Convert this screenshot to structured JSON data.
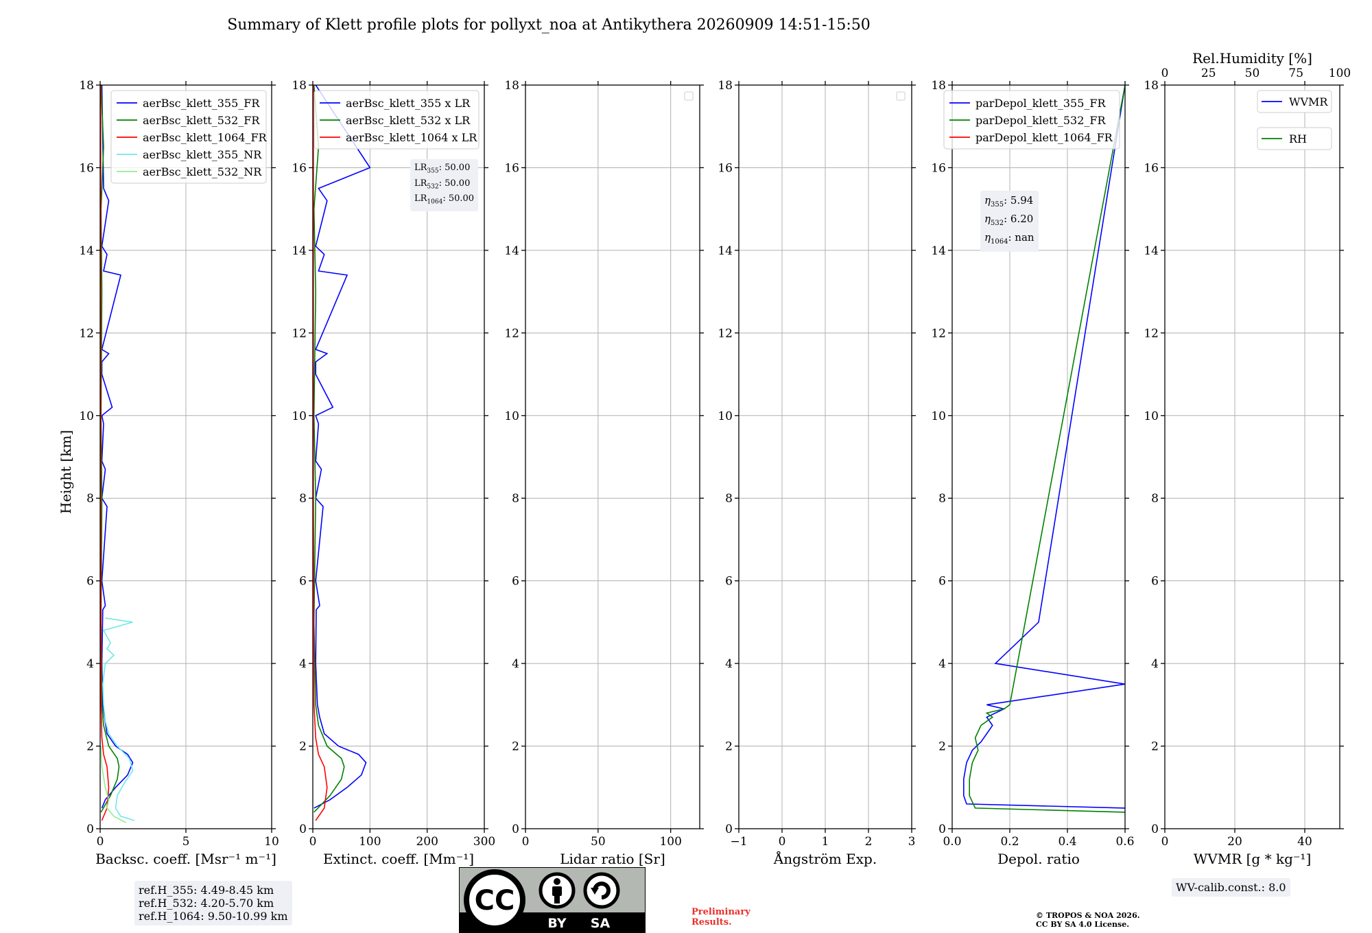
{
  "figure": {
    "title": "Summary of Klett profile plots for pollyxt_noa at Antikythera 20260909 14:51-15:50",
    "ylabel": "Height [km]"
  },
  "chart_data": [
    {
      "id": "backscatter",
      "type": "line",
      "xlabel": "Backsc. coeff. [Msr⁻¹ m⁻¹]",
      "ylabel": "Height [km]",
      "xlim": [
        0,
        10
      ],
      "ylim": [
        0,
        18
      ],
      "xticks": [
        "0",
        "5",
        "10"
      ],
      "yticks": [
        "0",
        "2",
        "4",
        "6",
        "8",
        "10",
        "12",
        "14",
        "16",
        "18"
      ],
      "grid": true,
      "legend": "top-right",
      "series": [
        {
          "name": "aerBsc_klett_355_FR",
          "color": "#0000ff",
          "x": [
            0.1,
            0.3,
            0.9,
            1.6,
            1.9,
            1.6,
            0.9,
            0.4,
            0.25,
            0.15,
            0.1,
            0.15,
            0.3,
            0.1,
            0.4,
            0.1,
            0.3,
            0.1,
            0.2,
            0.1,
            0.7,
            0.1,
            0.1,
            0.5,
            0.1,
            1.2,
            0.2,
            0.4,
            0.1,
            0.5,
            0.2,
            0.1
          ],
          "y": [
            0.5,
            0.7,
            1.0,
            1.3,
            1.6,
            1.8,
            2.0,
            2.3,
            2.7,
            3.0,
            4.0,
            5.3,
            5.4,
            6.0,
            7.8,
            8.0,
            8.7,
            8.9,
            9.8,
            10.0,
            10.2,
            11.0,
            11.3,
            11.5,
            11.6,
            13.4,
            13.5,
            13.9,
            14.1,
            15.2,
            15.5,
            18.0
          ]
        },
        {
          "name": "aerBsc_klett_532_FR",
          "color": "#008000",
          "x": [
            0.05,
            0.6,
            1.0,
            1.1,
            1.0,
            0.5,
            0.2,
            0.1,
            0.05,
            0.1,
            0.05,
            0.1,
            0.05,
            0.2,
            0.05
          ],
          "y": [
            0.4,
            0.8,
            1.2,
            1.5,
            1.7,
            2.0,
            2.5,
            3.0,
            5.0,
            8.0,
            10.0,
            13.0,
            15.0,
            16.5,
            18.0
          ]
        },
        {
          "name": "aerBsc_klett_1064_FR",
          "color": "#ff0000",
          "x": [
            0.1,
            0.4,
            0.5,
            0.4,
            0.2,
            0.1,
            0.05,
            0.03,
            0.03
          ],
          "y": [
            0.2,
            0.5,
            1.0,
            1.5,
            1.8,
            2.2,
            3.0,
            8.0,
            18.0
          ]
        },
        {
          "name": "aerBsc_klett_355_NR",
          "color": "#6fe8e8",
          "x": [
            2.0,
            1.2,
            0.9,
            1.0,
            1.4,
            1.9,
            1.7,
            1.0,
            0.5,
            0.3,
            0.2,
            0.15,
            0.3,
            0.8,
            0.4,
            0.6,
            0.2,
            1.9,
            0.3
          ],
          "y": [
            0.2,
            0.3,
            0.5,
            0.8,
            1.1,
            1.4,
            1.7,
            2.0,
            2.3,
            2.6,
            3.0,
            3.5,
            4.0,
            4.2,
            4.35,
            4.5,
            4.8,
            5.0,
            5.1
          ]
        },
        {
          "name": "aerBsc_klett_532_NR",
          "color": "#90ee90",
          "x": [
            1.5,
            0.8,
            0.4,
            0.5,
            0.3,
            0.1,
            0.05
          ],
          "y": [
            0.15,
            0.3,
            0.5,
            0.7,
            1.0,
            1.5,
            2.0
          ]
        }
      ],
      "annotations": {
        "refH": [
          "ref.H_355: 4.49-8.45 km",
          "ref.H_532: 4.20-5.70 km",
          "ref.H_1064: 9.50-10.99 km"
        ]
      }
    },
    {
      "id": "extinction",
      "type": "line",
      "xlabel": "Extinct. coeff. [Mm⁻¹]",
      "xlim": [
        0,
        300
      ],
      "ylim": [
        0,
        18
      ],
      "xticks": [
        "0",
        "100",
        "200",
        "300"
      ],
      "yticks": [
        "0",
        "2",
        "4",
        "6",
        "8",
        "10",
        "12",
        "14",
        "16",
        "18"
      ],
      "grid": true,
      "legend": "top-right",
      "series": [
        {
          "name": "aerBsc_klett_355 x LR",
          "color": "#0000ff",
          "x": [
            2,
            30,
            60,
            85,
            93,
            80,
            45,
            20,
            12,
            8,
            5,
            6,
            12,
            5,
            18,
            5,
            15,
            5,
            10,
            5,
            35,
            5,
            5,
            25,
            5,
            60,
            10,
            20,
            5,
            25,
            10,
            100,
            5
          ],
          "y": [
            0.5,
            0.7,
            1.0,
            1.3,
            1.6,
            1.8,
            2.0,
            2.3,
            2.7,
            3.0,
            4.0,
            5.3,
            5.4,
            6.0,
            7.8,
            8.0,
            8.7,
            8.9,
            9.8,
            10.0,
            10.2,
            11.0,
            11.3,
            11.5,
            11.6,
            13.4,
            13.5,
            13.9,
            14.1,
            15.2,
            15.5,
            16.0,
            18.0
          ]
        },
        {
          "name": "aerBsc_klett_532 x LR",
          "color": "#008000",
          "x": [
            2,
            30,
            50,
            55,
            50,
            25,
            10,
            5,
            2,
            5,
            2,
            5,
            2,
            10,
            2
          ],
          "y": [
            0.4,
            0.8,
            1.2,
            1.5,
            1.7,
            2.0,
            2.5,
            3.0,
            5.0,
            8.0,
            10.0,
            13.0,
            15.0,
            16.5,
            18.0
          ]
        },
        {
          "name": "aerBsc_klett_1064 x LR",
          "color": "#ff0000",
          "x": [
            5,
            20,
            25,
            20,
            10,
            5,
            2,
            1,
            1
          ],
          "y": [
            0.2,
            0.5,
            1.0,
            1.5,
            1.8,
            2.2,
            3.0,
            8.0,
            18.0
          ]
        }
      ],
      "annotations": {
        "LR355": "50.00",
        "LR532": "50.00",
        "LR1064": "50.00"
      }
    },
    {
      "id": "lidar_ratio",
      "type": "line",
      "xlabel": "Lidar ratio [Sr]",
      "xlim": [
        0,
        120
      ],
      "ylim": [
        0,
        18
      ],
      "xticks": [
        "0",
        "50",
        "100"
      ],
      "yticks": [
        "0",
        "2",
        "4",
        "6",
        "8",
        "10",
        "12",
        "14",
        "16",
        "18"
      ],
      "grid": true,
      "series": []
    },
    {
      "id": "angstrom",
      "type": "line",
      "xlabel": "Ångström Exp.",
      "xlim": [
        -1,
        3
      ],
      "ylim": [
        0,
        18
      ],
      "xticks": [
        "−1",
        "0",
        "1",
        "2",
        "3"
      ],
      "yticks": [
        "0",
        "2",
        "4",
        "6",
        "8",
        "10",
        "12",
        "14",
        "16",
        "18"
      ],
      "grid": true,
      "series": []
    },
    {
      "id": "depol",
      "type": "line",
      "xlabel": "Depol. ratio",
      "xlim": [
        0,
        0.6
      ],
      "ylim": [
        0,
        18
      ],
      "xticks": [
        "0.0",
        "0.2",
        "0.4",
        "0.6"
      ],
      "yticks": [
        "0",
        "2",
        "4",
        "6",
        "8",
        "10",
        "12",
        "14",
        "16",
        "18"
      ],
      "grid": true,
      "legend": "top-right",
      "series": [
        {
          "name": "parDepol_klett_355_FR",
          "color": "#0000ff",
          "x": [
            0.6,
            0.05,
            0.04,
            0.04,
            0.05,
            0.07,
            0.1,
            0.12,
            0.14,
            0.12,
            0.18,
            0.12,
            0.6,
            0.15,
            0.3,
            0.6
          ],
          "y": [
            0.5,
            0.6,
            0.8,
            1.2,
            1.6,
            1.9,
            2.1,
            2.3,
            2.5,
            2.7,
            2.9,
            3.0,
            3.5,
            4.0,
            5.0,
            18.0
          ]
        },
        {
          "name": "parDepol_klett_532_FR",
          "color": "#008000",
          "x": [
            0.6,
            0.08,
            0.06,
            0.06,
            0.07,
            0.09,
            0.08,
            0.1,
            0.14,
            0.12,
            0.18,
            0.2,
            0.6
          ],
          "y": [
            0.4,
            0.5,
            0.8,
            1.2,
            1.6,
            1.9,
            2.2,
            2.5,
            2.7,
            2.8,
            2.9,
            3.0,
            18.0
          ]
        },
        {
          "name": "parDepol_klett_1064_FR",
          "color": "#ff0000",
          "x": [],
          "y": []
        }
      ],
      "annotations": {
        "eta355": "5.94",
        "eta532": "6.20",
        "eta1064": "nan"
      }
    },
    {
      "id": "wvmr",
      "type": "line",
      "xlabel": "WVMR [g * kg⁻¹]",
      "top_xlabel": "Rel.Humidity [%]",
      "xlim": [
        0,
        50
      ],
      "ylim": [
        0,
        18
      ],
      "xticks": [
        "0",
        "20",
        "40"
      ],
      "top_xticks": [
        "0",
        "25",
        "50",
        "75",
        "100"
      ],
      "yticks": [
        "0",
        "2",
        "4",
        "6",
        "8",
        "10",
        "12",
        "14",
        "16",
        "18"
      ],
      "grid": true,
      "legend": "top-right",
      "series": [
        {
          "name": "WVMR",
          "color": "#0000ff",
          "x": [],
          "y": []
        },
        {
          "name": "RH",
          "color": "#008000",
          "x": [],
          "y": []
        }
      ],
      "annotations": {
        "wv_calib": "WV-calib.const.: 8.0"
      }
    }
  ],
  "footer": {
    "license_top": "CC",
    "license_by": "BY",
    "license_sa": "SA",
    "preliminary": "Preliminary\nResults.",
    "copyright": "© TROPOS & NOA 2026.\nCC BY SA 4.0 License."
  }
}
